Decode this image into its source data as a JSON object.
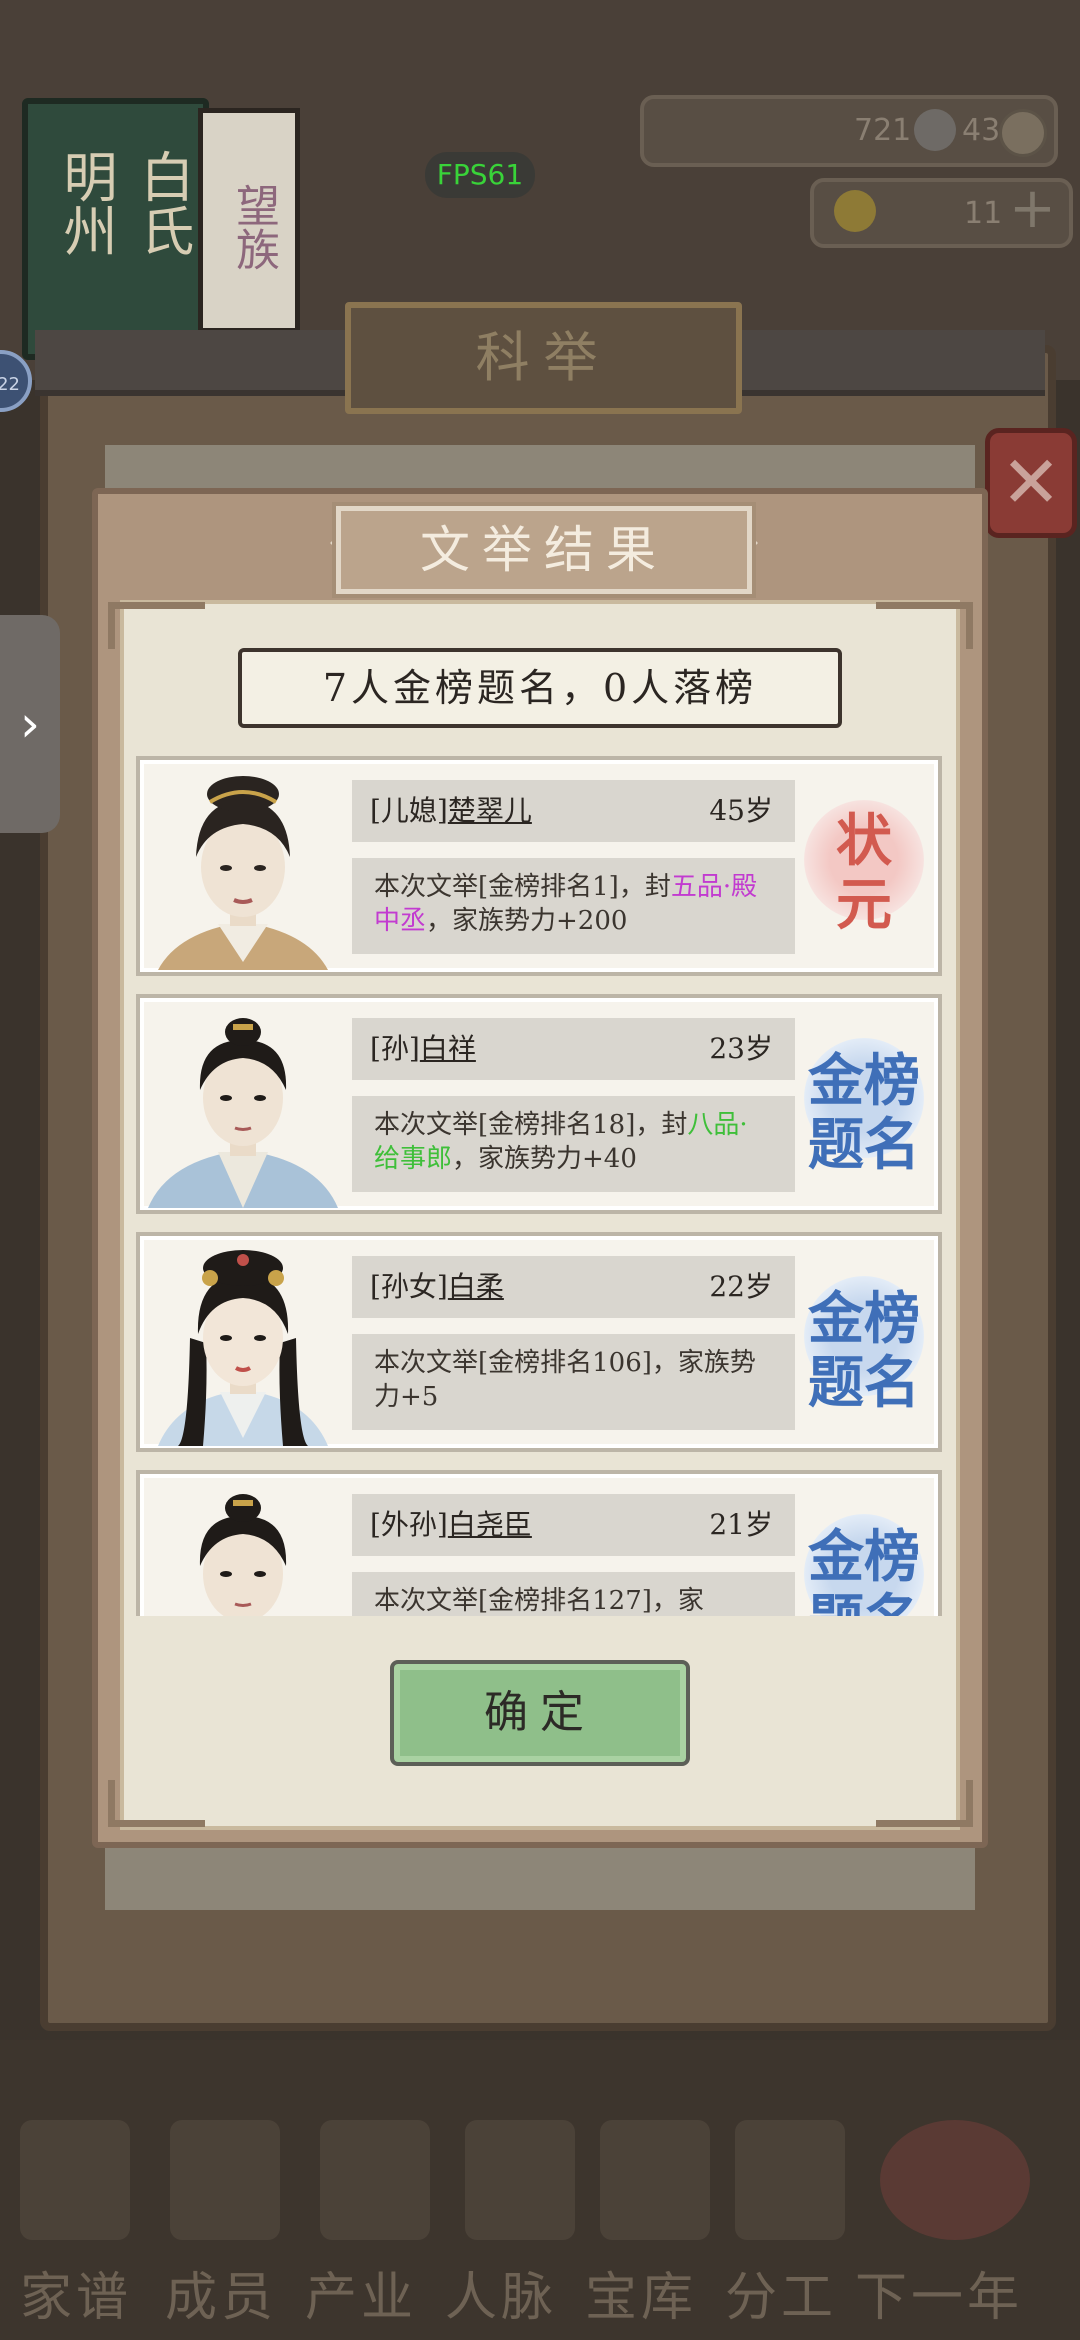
{
  "background": {
    "clan_name_left": "明州",
    "clan_name_right": "白氏",
    "clan_tag": "望族",
    "fps": "FPS61",
    "resource_1": "721",
    "resource_2": "43",
    "resource_3": "11",
    "level_badge": "22",
    "exam_title": "科举",
    "nav": [
      "家谱",
      "成员",
      "产业",
      "人脉",
      "宝库",
      "分工",
      "下一年"
    ]
  },
  "modal": {
    "title": "文举结果",
    "summary": "7人金榜题名，0人落榜",
    "confirm_label": "确定",
    "results": [
      {
        "relation": "[儿媳]",
        "name": "楚翠儿",
        "age": "45岁",
        "desc_prefix": "本次文举[金榜排名1]，封",
        "desc_highlight": "五品·殿中丞",
        "desc_suffix": "，家族势力+200",
        "highlight_color": "#c23bd0",
        "stamp_line1": "状",
        "stamp_line2": "元",
        "stamp_color": "#d25a4f"
      },
      {
        "relation": "[孙]",
        "name": "白祥",
        "age": "23岁",
        "desc_prefix": "本次文举[金榜排名18]，封",
        "desc_highlight": "八品·给事郎",
        "desc_suffix": "，家族势力+40",
        "highlight_color": "#3fbf3a",
        "stamp_line1": "金榜",
        "stamp_line2": "题名",
        "stamp_color": "#3f6fb8"
      },
      {
        "relation": "[孙女]",
        "name": "白柔",
        "age": "22岁",
        "desc_prefix": "本次文举[金榜排名106]，家族势力+5",
        "desc_highlight": "",
        "desc_suffix": "",
        "highlight_color": "#3fbf3a",
        "stamp_line1": "金榜",
        "stamp_line2": "题名",
        "stamp_color": "#3f6fb8"
      },
      {
        "relation": "[外孙]",
        "name": "白尧臣",
        "age": "21岁",
        "desc_prefix": "本次文举[金榜排名127]，家",
        "desc_highlight": "",
        "desc_suffix": "",
        "highlight_color": "#3fbf3a",
        "stamp_line1": "金榜",
        "stamp_line2": "题名",
        "stamp_color": "#3f6fb8"
      }
    ]
  }
}
